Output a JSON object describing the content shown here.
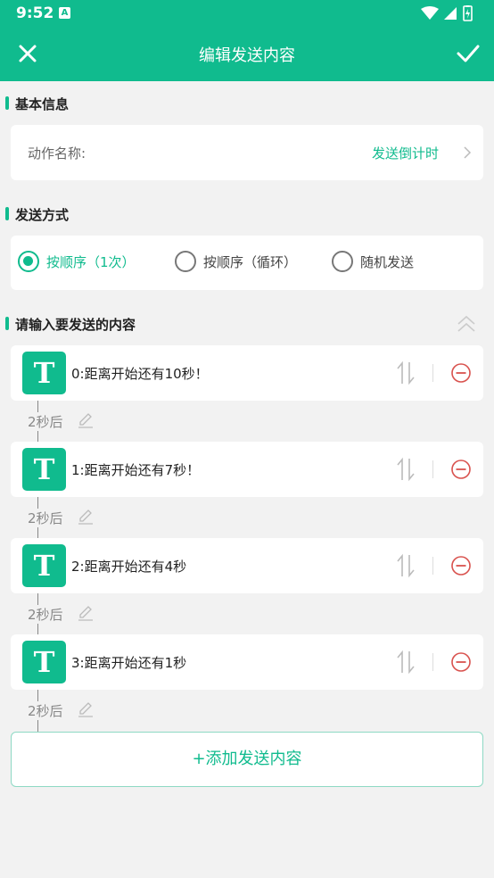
{
  "status_bar": {
    "time": "9:52",
    "notification_icon": "A"
  },
  "header": {
    "title": "编辑发送内容"
  },
  "basic_info": {
    "section_title": "基本信息",
    "name_label": "动作名称:",
    "name_value": "发送倒计时"
  },
  "send_mode": {
    "section_title": "发送方式",
    "options": [
      {
        "label": "按顺序（1次）",
        "selected": true
      },
      {
        "label": "按顺序（循环）",
        "selected": false
      },
      {
        "label": "随机发送",
        "selected": false
      }
    ]
  },
  "content": {
    "section_title": "请输入要发送的内容",
    "type_icon": "T",
    "items": [
      {
        "text": "0:距离开始还有10秒！",
        "delay": "2秒后"
      },
      {
        "text": "1:距离开始还有7秒！",
        "delay": "2秒后"
      },
      {
        "text": "2:距离开始还有4秒",
        "delay": "2秒后"
      },
      {
        "text": "3:距离开始还有1秒",
        "delay": "2秒后"
      }
    ],
    "add_button": "+添加发送内容"
  },
  "colors": {
    "accent": "#10bb8e",
    "remove": "#d9534f",
    "background": "#f2f2f2"
  }
}
